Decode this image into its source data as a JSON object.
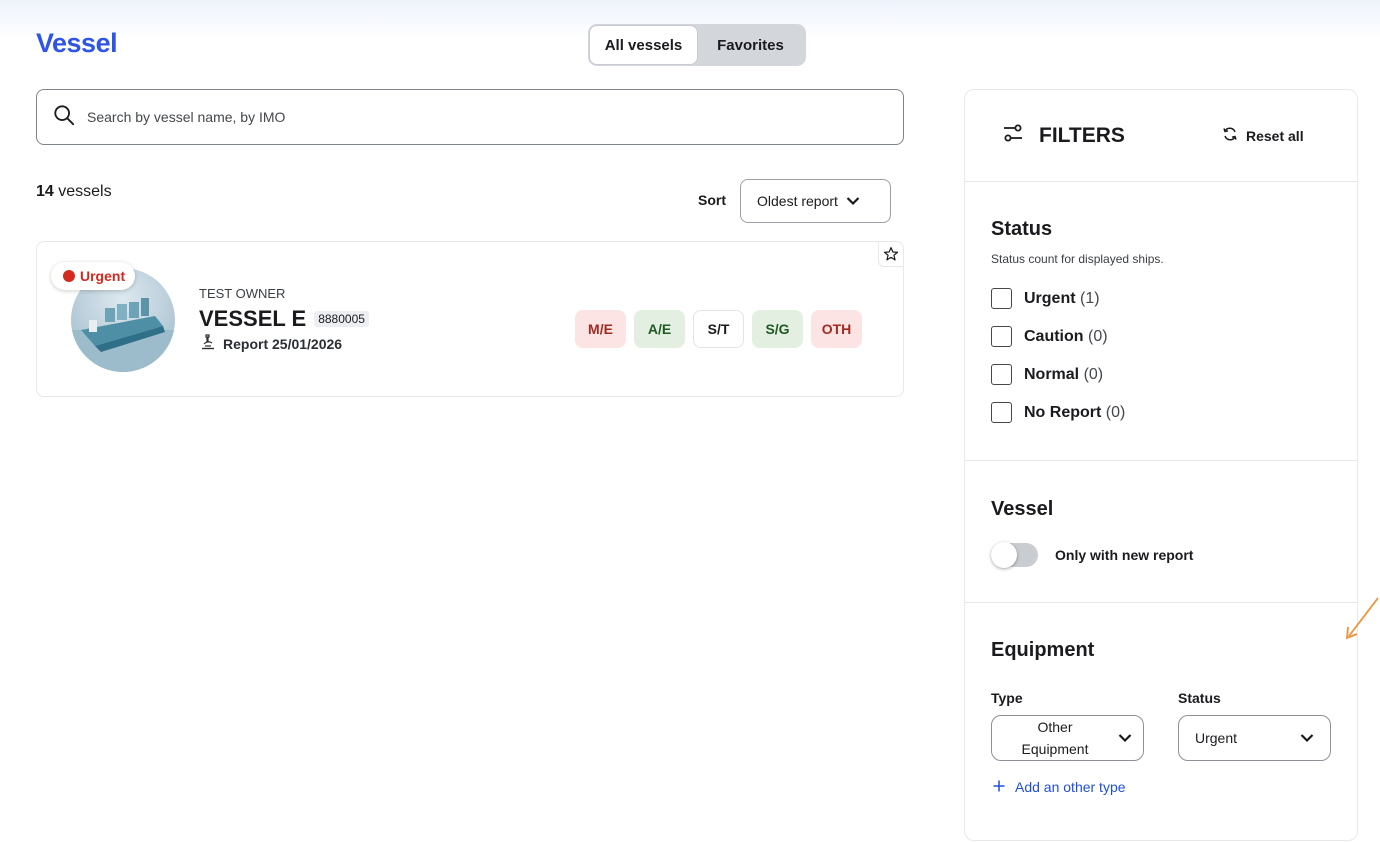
{
  "header": {
    "logo": "Vessel",
    "tabs": [
      {
        "label": "All vessels",
        "active": true
      },
      {
        "label": "Favorites",
        "active": false
      }
    ]
  },
  "search": {
    "placeholder": "Search by vessel name, by IMO",
    "value": ""
  },
  "list": {
    "count": "14",
    "count_suffix": " vessels",
    "sort_label": "Sort",
    "sort_value": "Oldest report"
  },
  "vessel_card": {
    "status_badge": "Urgent",
    "owner": "TEST OWNER",
    "name": "VESSEL E",
    "imo": "8880005",
    "report": "Report 25/01/2026",
    "tags": [
      {
        "label": "M/E",
        "bg": "#fbe4e3",
        "fg": "#a12b22",
        "border": "#fbe4e3"
      },
      {
        "label": "A/E",
        "bg": "#e3f0e1",
        "fg": "#1f5a24",
        "border": "#e3f0e1"
      },
      {
        "label": "S/T",
        "bg": "#ffffff",
        "fg": "#1b1b1f",
        "border": "#e2e4e7"
      },
      {
        "label": "S/G",
        "bg": "#e3f0e1",
        "fg": "#1f5a24",
        "border": "#e3f0e1"
      },
      {
        "label": "OTH",
        "bg": "#fbe4e3",
        "fg": "#a12b22",
        "border": "#fbe4e3"
      }
    ]
  },
  "filters": {
    "title": "FILTERS",
    "reset_label": "Reset all",
    "status": {
      "title": "Status",
      "subtitle": "Status count for displayed ships.",
      "options": [
        {
          "label": "Urgent",
          "count": "(1)"
        },
        {
          "label": "Caution",
          "count": "(0)"
        },
        {
          "label": "Normal",
          "count": "(0)"
        },
        {
          "label": "No Report",
          "count": "(0)"
        }
      ]
    },
    "vessel": {
      "title": "Vessel",
      "toggle_label": "Only with new report"
    },
    "equipment": {
      "title": "Equipment",
      "type_label": "Type",
      "type_value_line1": "Other",
      "type_value_line2": "Equipment",
      "status_label": "Status",
      "status_value": "Urgent",
      "add_label": "Add an other type"
    }
  },
  "colors": {
    "brand": "#2f55e6",
    "urgent": "#d32a20",
    "link": "#1f4fd8",
    "annotation_arrow": "#f0923a"
  }
}
